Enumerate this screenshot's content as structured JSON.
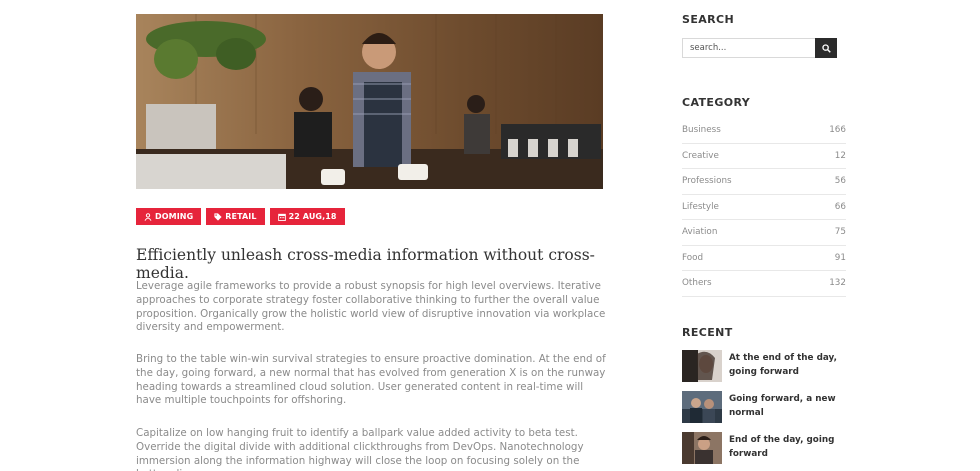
{
  "post": {
    "tags": [
      {
        "icon": "user-icon",
        "label": "DOMING"
      },
      {
        "icon": "tag-icon",
        "label": "RETAIL"
      },
      {
        "icon": "calendar-icon",
        "label": "22 AUG,18"
      }
    ],
    "title": "Efficiently unleash cross-media information without cross-media.",
    "paragraphs": [
      "Leverage agile frameworks to provide a robust synopsis for high level overviews. Iterative approaches to corporate strategy foster collaborative thinking to further the overall value proposition. Organically grow the holistic world view of disruptive innovation via workplace diversity and empowerment.",
      "Bring to the table win-win survival strategies to ensure proactive domination. At the end of the day, going forward, a new normal that has evolved from generation X is on the runway heading towards a streamlined cloud solution. User generated content in real-time will have multiple touchpoints for offshoring.",
      "Capitalize on low hanging fruit to identify a ballpark value added activity to beta test. Override the digital divide with additional clickthroughs from DevOps. Nanotechnology immersion along the information highway will close the loop on focusing solely on the bottom line."
    ]
  },
  "sidebar": {
    "search": {
      "heading": "SEARCH",
      "placeholder": "search..."
    },
    "category": {
      "heading": "CATEGORY",
      "items": [
        {
          "name": "Business",
          "count": "166"
        },
        {
          "name": "Creative",
          "count": "12"
        },
        {
          "name": "Professions",
          "count": "56"
        },
        {
          "name": "Lifestyle",
          "count": "66"
        },
        {
          "name": "Aviation",
          "count": "75"
        },
        {
          "name": "Food",
          "count": "91"
        },
        {
          "name": "Others",
          "count": "132"
        }
      ]
    },
    "recent": {
      "heading": "RECENT",
      "items": [
        {
          "title_line1": "At the end of the day,",
          "title_line2": "going forward"
        },
        {
          "title_line1": "Going forward, a new",
          "title_line2": "normal"
        },
        {
          "title_line1": "End of the day, going",
          "title_line2": "forward"
        }
      ]
    }
  },
  "colors": {
    "accent": "#e6243b",
    "dark": "#2b2b2b",
    "muted": "#8b8b8b"
  }
}
